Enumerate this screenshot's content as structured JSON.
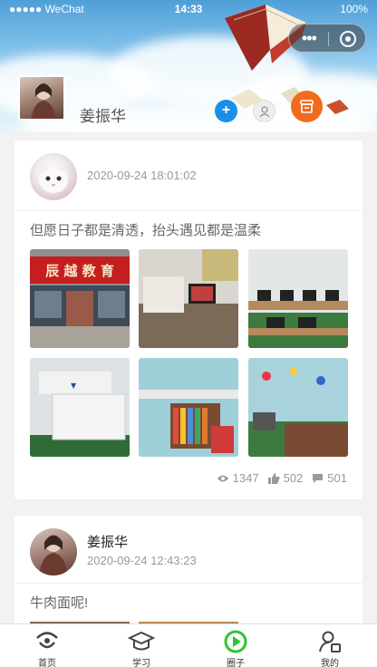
{
  "status_bar": {
    "carrier": "●●●●● WeChat",
    "time": "14:33",
    "battery": "100%"
  },
  "profile": {
    "name": "姜振华"
  },
  "posts": [
    {
      "date": "2020-09-24 18:01:02",
      "text": "但愿日子都是清透，抬头遇见都是温柔",
      "views": "1347",
      "likes": "502",
      "comments": "501",
      "photo_sign": "辰 越 教 育"
    },
    {
      "author": "姜振华",
      "date": "2020-09-24 12:43:23",
      "text": "牛肉面呢!"
    }
  ],
  "tabbar": {
    "items": [
      {
        "label": "首页",
        "icon": "home-icon"
      },
      {
        "label": "学习",
        "icon": "graduation-cap-icon"
      },
      {
        "label": "圈子",
        "icon": "play-circle-icon"
      },
      {
        "label": "我的",
        "icon": "profile-icon"
      }
    ],
    "active": "圈子"
  },
  "colors": {
    "accent_blue": "#1a8ee8",
    "shop_orange": "#f26b1d",
    "active_tab_green": "#2ec52e"
  }
}
